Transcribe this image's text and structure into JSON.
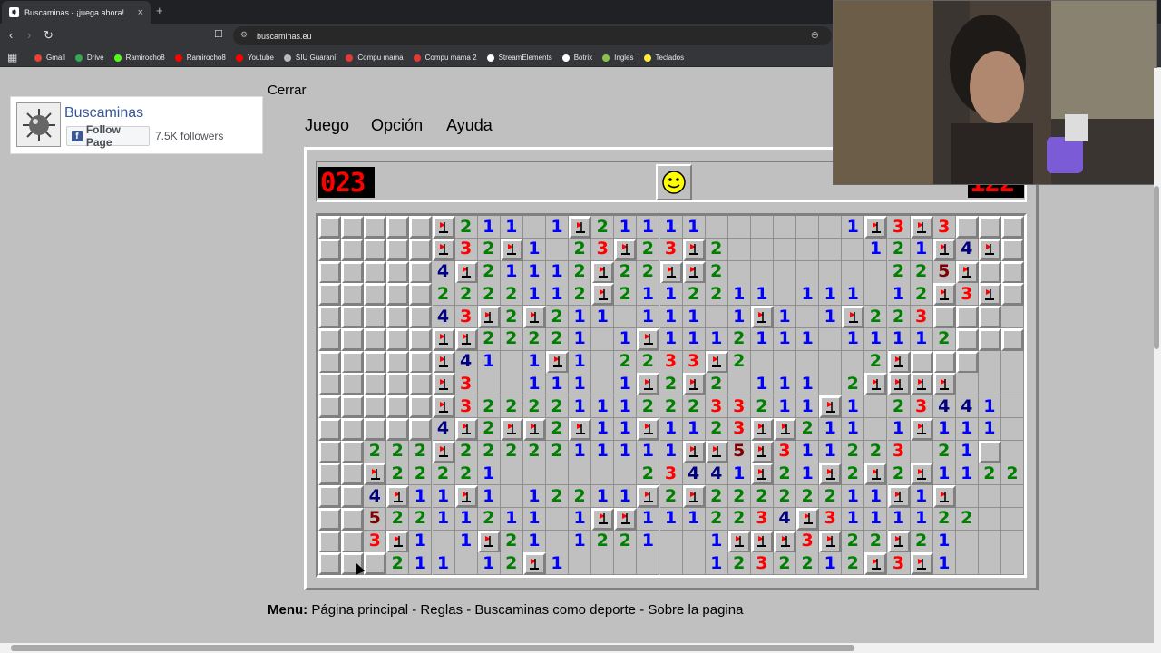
{
  "browser": {
    "tab_title": "Buscaminas - ¡juega ahora!",
    "tab_close": "×",
    "new_tab": "+",
    "url": "buscaminas.eu",
    "bookmarks": [
      {
        "label": "Gmail",
        "color": "#ea4335"
      },
      {
        "label": "Drive",
        "color": "#34a853"
      },
      {
        "label": "Ramirocho8",
        "color": "#53fc18"
      },
      {
        "label": "Ramirocho8",
        "color": "#ff0000"
      },
      {
        "label": "Youtube",
        "color": "#ff0000"
      },
      {
        "label": "SIU Guaraní",
        "color": "#bbbbbb"
      },
      {
        "label": "Compu mama",
        "color": "#e53935"
      },
      {
        "label": "Compu mama 2",
        "color": "#e53935"
      },
      {
        "label": "StreamElements",
        "color": "#ffffff"
      },
      {
        "label": "Botrix",
        "color": "#ffffff"
      },
      {
        "label": "Ingles",
        "color": "#8bc34a"
      },
      {
        "label": "Teclados",
        "color": "#ffeb3b"
      }
    ]
  },
  "facebook": {
    "name": "Buscaminas",
    "follow_label": "Follow Page",
    "followers": "7.5K followers"
  },
  "close_label": "Cerrar",
  "menus": [
    "Juego",
    "Opción",
    "Ayuda"
  ],
  "game": {
    "mines_left": "023",
    "timer": "122",
    "face": "smiley",
    "rows": [
      "uuuuuF211 1F21111      1F3F3uuu",
      "uuuuuF32F1 23F23F2      121F4Fuuu",
      "uuuuu4F21112F22FF2       225Fuuu",
      "uuuuu2222112F2112211 111 12F3Fuuu",
      "uuuuu43F2F211 111 1F1 1F223uuu",
      "uuuuuFF22221 1F1112111 11112uuu",
      "uuuuuF41 1F1 2233F2     2Fuuu",
      "uuuuuF3  111 1F2F2 111 2FFFF",
      "uuuuuF3222211122233211F1 23441",
      "uuuuu4F2FF2F11F1123FF211 1F111",
      "uu222F2222211111FF5F311223 21u",
      "uuF22221      23441F21F2F2F1122",
      "uu4F11F1 12211F2F22222211F1F",
      "uu52211211 1FF1112234F3111122",
      "uu3F1 1F21 1221  1FFF3F22F21",
      "uuu211 12F1      1232212F3F1"
    ]
  },
  "footer": {
    "label": "Menu:",
    "items": "Página principal - Reglas - Buscaminas como deporte - Sobre la pagina"
  }
}
